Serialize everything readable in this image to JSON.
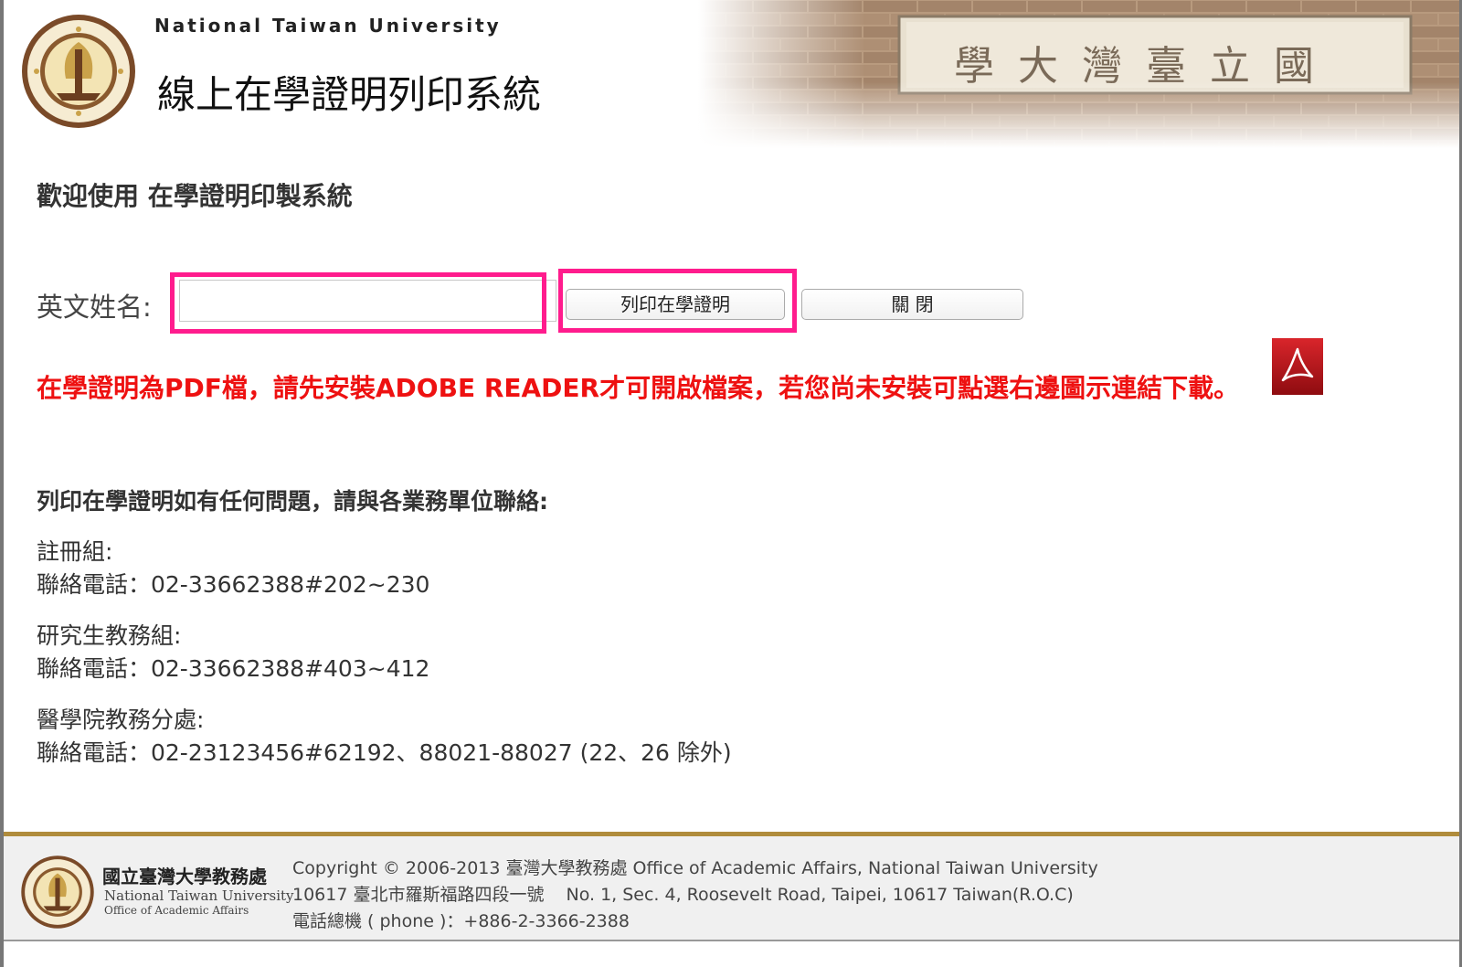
{
  "header": {
    "university_en": "National Taiwan University",
    "system_title": "線上在學證明列印系統",
    "banner_plaque": "國立臺灣大學"
  },
  "main": {
    "welcome": "歡迎使用 在學證明印製系統",
    "form": {
      "name_label": "英文姓名:",
      "name_value": "",
      "print_button": "列印在學證明",
      "close_button": "關 閉"
    },
    "notice": "在學證明為PDF檔，請先安裝ADOBE READER才可開啟檔案，若您尚未安裝可點選右邊圖示連結下載。",
    "contact_heading": "列印在學證明如有任何問題，請與各業務單位聯絡:",
    "units": [
      {
        "name": "註冊組:",
        "phone": "聯絡電話：02-33662388#202~230"
      },
      {
        "name": "研究生教務組:",
        "phone": "聯絡電話：02-33662388#403~412"
      },
      {
        "name": "醫學院教務分處:",
        "phone": "聯絡電話：02-23123456#62192、88021-88027 (22、26 除外)"
      }
    ]
  },
  "footer": {
    "dept_zh": "國立臺灣大學教務處",
    "dept_en": "National Taiwan University",
    "dept_en_sub": "Office of Academic Affairs",
    "copyright": "Copyright © 2006-2013 臺灣大學教務處 Office of Academic Affairs, National Taiwan University",
    "address_zh": "10617 臺北市羅斯福路四段一號",
    "address_en": "No. 1, Sec. 4, Roosevelt Road, Taipei, 10617 Taiwan(R.O.C)",
    "phone": "電話總機 ( phone )：+886-2-3366-2388"
  },
  "colors": {
    "highlight": "#ff1c8d",
    "notice_red": "#ee1111",
    "footer_gold": "#b08c3c",
    "adobe_red": "#c4141a"
  },
  "icons": {
    "logo": "ntu-seal-icon",
    "pdf": "adobe-reader-icon"
  }
}
